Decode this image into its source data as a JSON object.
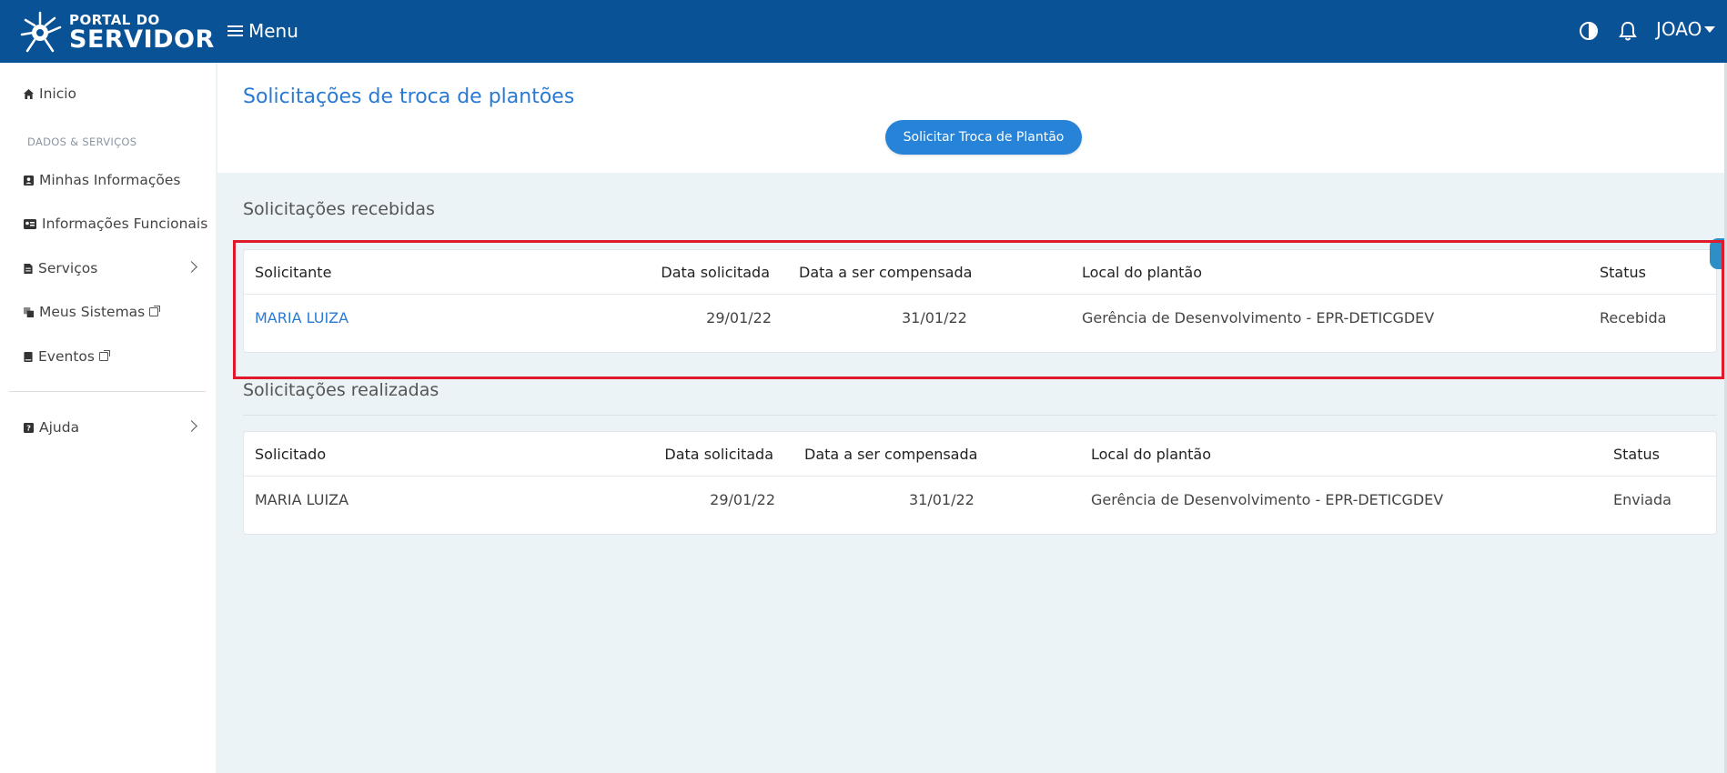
{
  "header": {
    "logo_line1": "PORTAL DO",
    "logo_line2": "SERVIDOR",
    "menu_label": "Menu",
    "user_name": "JOAO",
    "bg_color": "#0a5296"
  },
  "sidebar": {
    "home": "Inicio",
    "section_label": "DADOS & SERVIÇOS",
    "items": [
      {
        "label": "Minhas Informações",
        "icon": "contact-card-icon"
      },
      {
        "label": "Informações Funcionais",
        "icon": "id-card-icon"
      },
      {
        "label": "Serviços",
        "icon": "document-icon"
      },
      {
        "label": "Meus Sistemas",
        "icon": "copy-icon"
      },
      {
        "label": "Eventos",
        "icon": "book-icon"
      }
    ],
    "help": "Ajuda"
  },
  "main": {
    "title": "Solicitações de troca de plantões",
    "request_button": "Solicitar Troca de Plantão",
    "received": {
      "title": "Solicitações recebidas",
      "headers": [
        "Solicitante",
        "Data solicitada",
        "Data a ser compensada",
        "Local do plantão",
        "Status"
      ],
      "rows": [
        [
          "MARIA LUIZA",
          "29/01/22",
          "31/01/22",
          "Gerência de Desenvolvimento - EPR-DETICGDEV",
          "Recebida"
        ]
      ]
    },
    "made": {
      "title": "Solicitações realizadas",
      "headers": [
        "Solicitado",
        "Data solicitada",
        "Data a ser compensada",
        "Local do plantão",
        "Status"
      ],
      "rows": [
        [
          "MARIA LUIZA",
          "29/01/22",
          "31/01/22",
          "Gerência de Desenvolvimento - EPR-DETICGDEV",
          "Enviada"
        ]
      ]
    }
  },
  "colors": {
    "accent": "#2a7ad4",
    "button": "#2683d8",
    "highlight": "#e0192b",
    "background": "#ecf3f6"
  }
}
